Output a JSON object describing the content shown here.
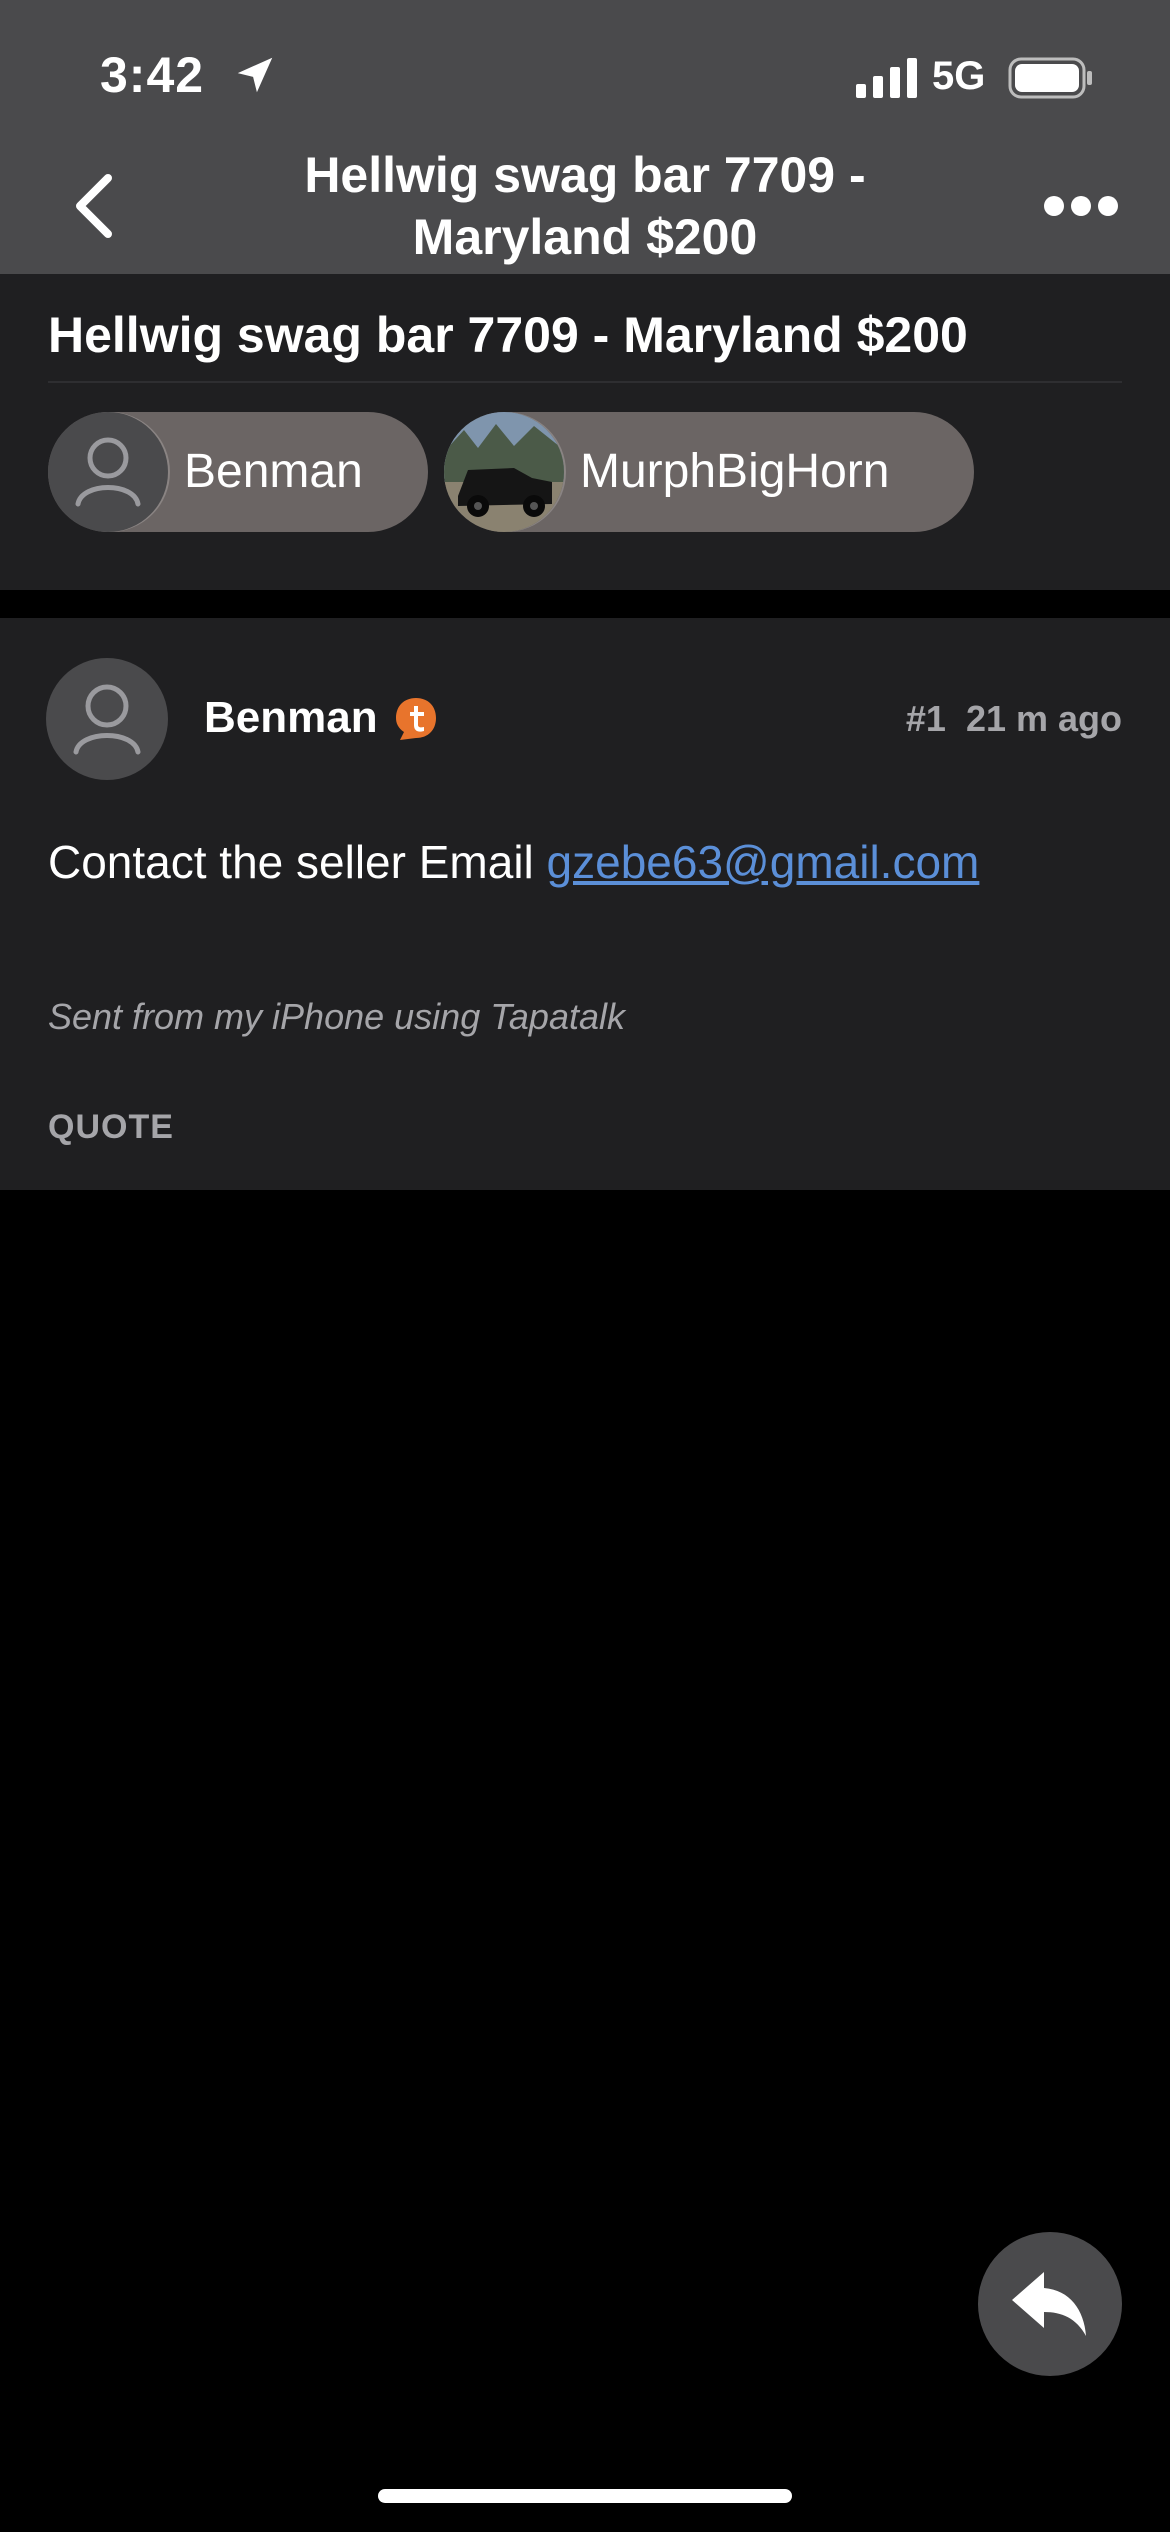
{
  "status_bar": {
    "time": "3:42",
    "network": "5G",
    "icons": [
      "location-arrow-icon",
      "signal-bars-icon",
      "battery-icon"
    ]
  },
  "nav": {
    "title": "Hellwig swag bar 7709 - Maryland $200",
    "back_icon": "chevron-left-icon",
    "more_icon": "ellipsis-icon"
  },
  "thread": {
    "title": "Hellwig swag bar 7709 - Maryland $200",
    "participants": [
      {
        "name": "Benman",
        "avatar": "default-user-icon"
      },
      {
        "name": "MurphBigHorn",
        "avatar": "truck-photo"
      }
    ]
  },
  "post": {
    "author": "Benman",
    "badge_icon": "tapatalk-badge-icon",
    "number": "#1",
    "time": "21 m ago",
    "body_prefix": "Contact the seller Email ",
    "email": "gzebe63@gmail.com",
    "signature": "Sent from my iPhone using Tapatalk",
    "quote_label": "QUOTE"
  },
  "fab": {
    "icon": "reply-icon"
  },
  "colors": {
    "header_bg": "#4a4a4c",
    "card_bg": "#1f1f21",
    "chip_bg": "#6b6564",
    "link": "#5b8fd8",
    "muted_text": "#a5a5a9",
    "badge": "#e8742c",
    "page_bg": "#000000"
  }
}
